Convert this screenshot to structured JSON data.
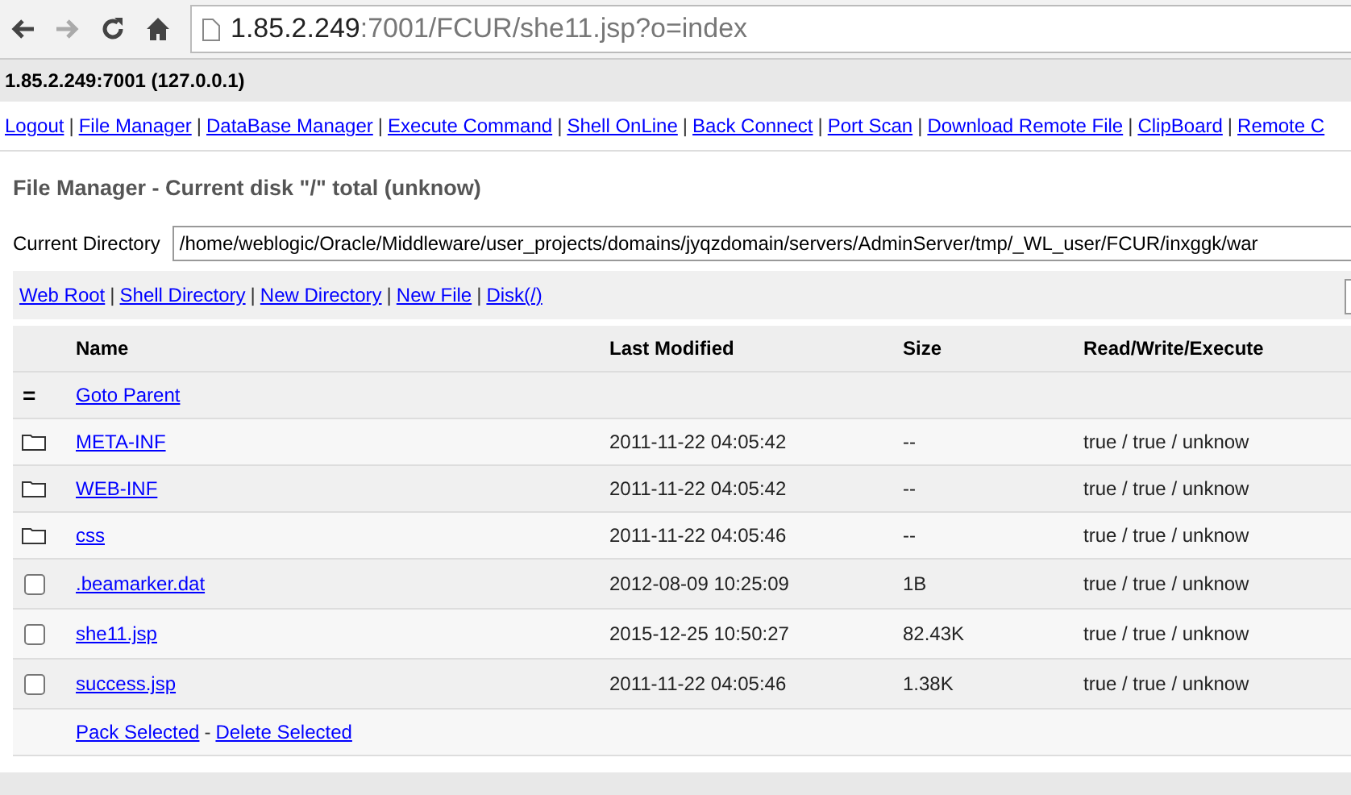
{
  "browser": {
    "url_host": "1.85.2.249",
    "url_rest": ":7001/FCUR/she11.jsp?o=index"
  },
  "host_bar": {
    "text": "1.85.2.249:7001 (127.0.0.1)"
  },
  "nav_links": [
    "Logout",
    "File Manager",
    "DataBase Manager",
    "Execute Command",
    "Shell OnLine",
    "Back Connect",
    "Port Scan",
    "Download Remote File",
    "ClipBoard",
    "Remote C"
  ],
  "nav_separator": "|",
  "toolbar_separator": "|",
  "title": "File Manager - Current disk \"/\" total (unknow)",
  "current_directory": {
    "label": "Current Directory",
    "value": "/home/weblogic/Oracle/Middleware/user_projects/domains/jyqzdomain/servers/AdminServer/tmp/_WL_user/FCUR/inxggk/war"
  },
  "toolbar_links": [
    "Web Root",
    "Shell Directory",
    "New Directory",
    "New File",
    "Disk(/)"
  ],
  "table": {
    "columns": [
      "Name",
      "Last Modified",
      "Size",
      "Read/Write/Execute"
    ],
    "rows": [
      {
        "kind": "parent",
        "marker": "=",
        "name": "Goto Parent"
      },
      {
        "kind": "folder",
        "name": "META-INF",
        "modified": "2011-11-22 04:05:42",
        "size": "--",
        "rwx": "true / true / unknow"
      },
      {
        "kind": "folder",
        "name": "WEB-INF",
        "modified": "2011-11-22 04:05:42",
        "size": "--",
        "rwx": "true / true / unknow"
      },
      {
        "kind": "folder",
        "name": "css",
        "modified": "2011-11-22 04:05:46",
        "size": "--",
        "rwx": "true / true / unknow"
      },
      {
        "kind": "file",
        "checked": false,
        "name": ".beamarker.dat",
        "modified": "2012-08-09 10:25:09",
        "size": "1B",
        "rwx": "true / true / unknow"
      },
      {
        "kind": "file",
        "checked": false,
        "name": "she11.jsp",
        "modified": "2015-12-25 10:50:27",
        "size": "82.43K",
        "rwx": "true / true / unknow"
      },
      {
        "kind": "file",
        "checked": false,
        "name": "success.jsp",
        "modified": "2011-11-22 04:05:46",
        "size": "1.38K",
        "rwx": "true / true / unknow"
      }
    ],
    "actions": [
      "Pack Selected",
      "Delete Selected"
    ],
    "action_separator": "-"
  }
}
